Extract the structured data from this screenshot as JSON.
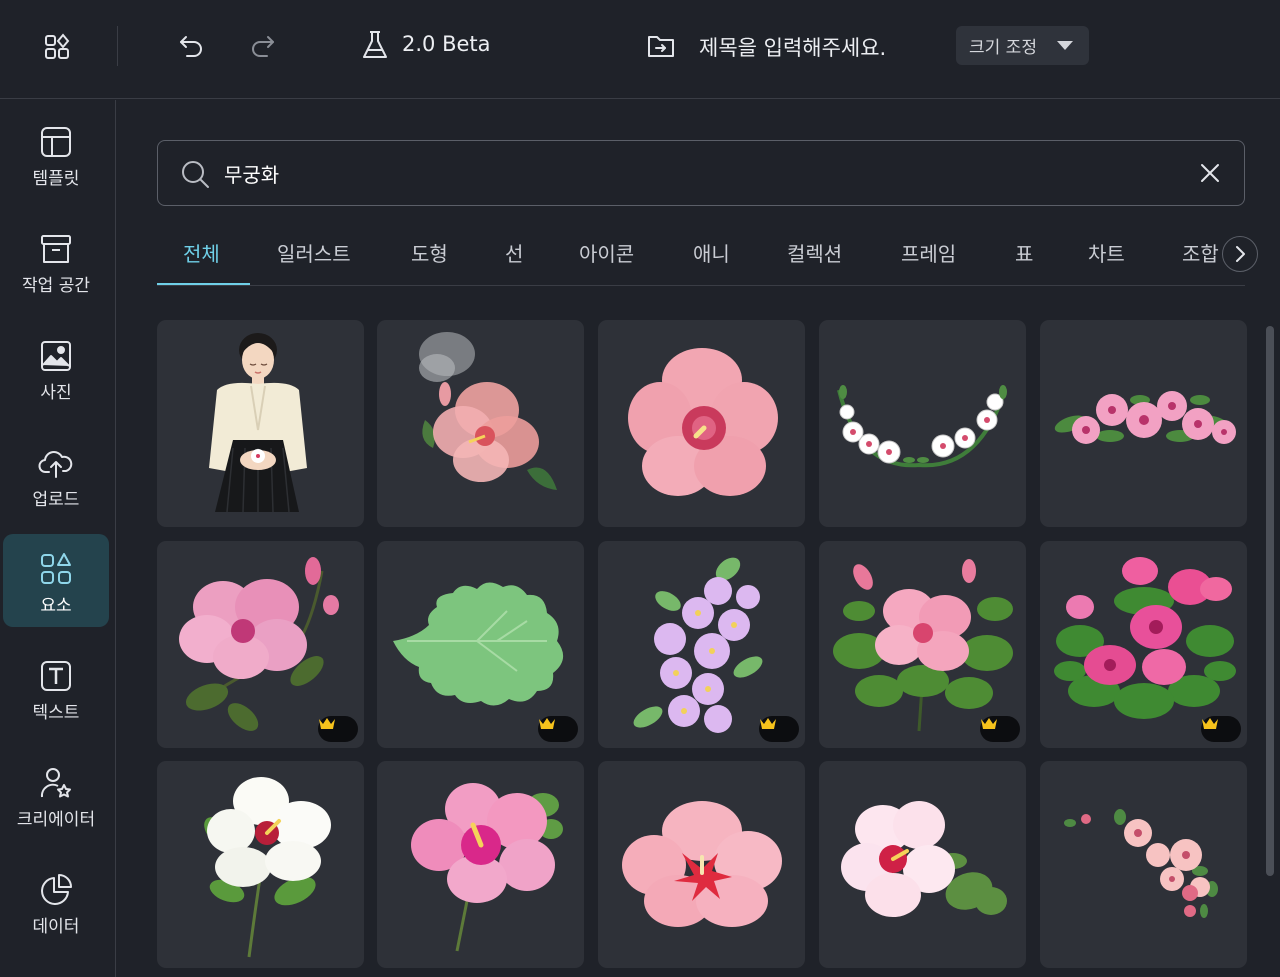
{
  "topbar": {
    "version_label": "2.0 Beta",
    "title_placeholder": "제목을 입력해주세요.",
    "resize_label": "크기 조정",
    "icons": [
      "apps-grid-icon",
      "undo-icon",
      "redo-icon",
      "flask-icon",
      "folder-move-icon"
    ]
  },
  "sidebar": {
    "items": [
      {
        "label": "템플릿",
        "icon": "template-icon"
      },
      {
        "label": "작업 공간",
        "icon": "archive-box-icon"
      },
      {
        "label": "사진",
        "icon": "image-icon"
      },
      {
        "label": "업로드",
        "icon": "cloud-upload-icon"
      },
      {
        "label": "요소",
        "icon": "shapes-icon",
        "active": true
      },
      {
        "label": "텍스트",
        "icon": "text-box-icon"
      },
      {
        "label": "크리에이터",
        "icon": "creator-star-icon"
      },
      {
        "label": "데이터",
        "icon": "pie-chart-icon"
      }
    ]
  },
  "search": {
    "value": "무궁화"
  },
  "tabs": [
    {
      "label": "전체",
      "active": true
    },
    {
      "label": "일러스트"
    },
    {
      "label": "도형"
    },
    {
      "label": "선"
    },
    {
      "label": "아이콘"
    },
    {
      "label": "애니"
    },
    {
      "label": "컬렉션"
    },
    {
      "label": "프레임"
    },
    {
      "label": "표"
    },
    {
      "label": "차트"
    },
    {
      "label": "조합"
    }
  ],
  "results": [
    {
      "name": "woman-in-hanbok-illustration",
      "premium": false
    },
    {
      "name": "watercolor-pink-hibiscus",
      "premium": false
    },
    {
      "name": "pink-mugunghwa-flower",
      "premium": false
    },
    {
      "name": "white-flower-garland",
      "premium": false
    },
    {
      "name": "pink-flower-border",
      "premium": false
    },
    {
      "name": "pink-hibiscus-branch",
      "premium": true
    },
    {
      "name": "green-leaf",
      "premium": true
    },
    {
      "name": "lilac-flower-cluster",
      "premium": true
    },
    {
      "name": "pink-hibiscus-bush",
      "premium": true
    },
    {
      "name": "magenta-hibiscus-bush",
      "premium": true
    },
    {
      "name": "white-hibiscus-stem",
      "premium": false
    },
    {
      "name": "magenta-hibiscus-stem",
      "premium": false
    },
    {
      "name": "pink-red-center-flower",
      "premium": false
    },
    {
      "name": "light-pink-hibiscus-leaves",
      "premium": false
    },
    {
      "name": "scattered-pink-blossoms",
      "premium": false
    }
  ],
  "colors": {
    "background": "#1f2229",
    "card": "#2e3138",
    "accent": "#6fd0e8",
    "active_sidebar": "#24434d",
    "crown": "#f6c21c"
  }
}
